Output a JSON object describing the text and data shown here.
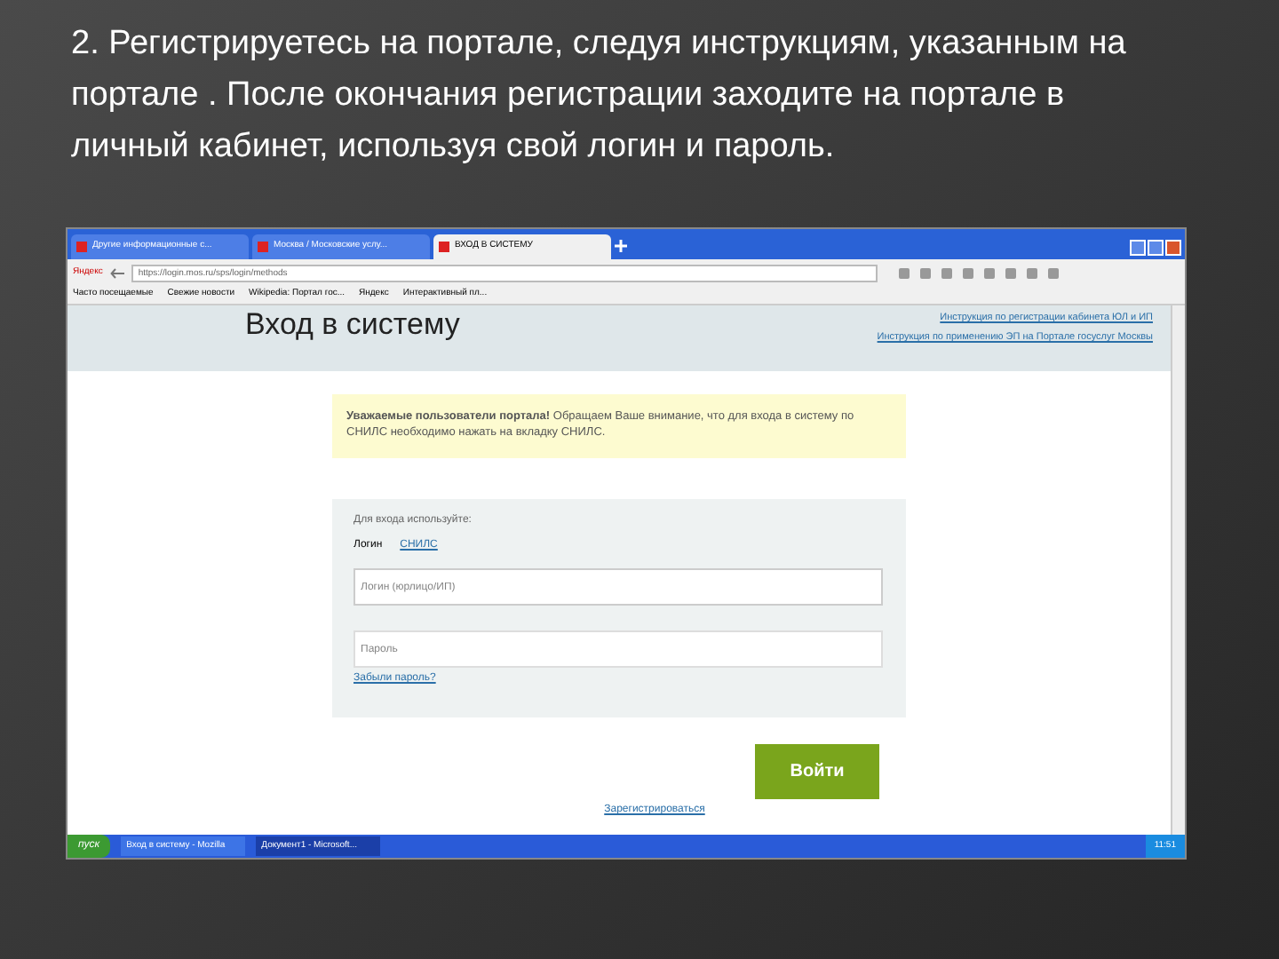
{
  "slide": {
    "heading": "2. Регистрируетесь на портале, следуя инструкциям, указанным на портале . После окончания регистрации заходите на портале в личный кабинет, используя свой логин и пароль."
  },
  "browser": {
    "tabs": [
      {
        "label": "Другие информационные с...",
        "selected": false
      },
      {
        "label": "Москва / Московские услу...",
        "selected": false
      },
      {
        "label": "ВХОД В СИСТЕМУ",
        "selected": true
      }
    ],
    "brand": "Яндекс",
    "address": "https://login.mos.ru/sps/login/methods",
    "bookmarks": [
      "Часто посещаемые",
      "Свежие новости",
      "Wikipedia: Портал гос...",
      "Яндекс",
      "Интерактивный пл..."
    ]
  },
  "page": {
    "title": "Вход в систему",
    "links": [
      "Инструкция по регистрации кабинета ЮЛ и ИП",
      "Инструкция по применению ЭП на Портале госуслуг Москвы"
    ],
    "notice_bold": "Уважаемые пользователи портала!",
    "notice": "Обращаем Ваше внимание, что для входа в систему по СНИЛС необходимо нажать на вкладку СНИЛС.",
    "form_heading": "Для входа используйте:",
    "login_tabs": [
      {
        "label": "Логин",
        "selected": true
      },
      {
        "label": "СНИЛС",
        "selected": false
      }
    ],
    "login_placeholder": "Логин (юрлицо/ИП)",
    "password_placeholder": "Пароль",
    "forgot": "Забыли пароль?",
    "submit": "Войти",
    "register": "Зарегистрироваться"
  },
  "taskbar": {
    "start": "пуск",
    "windows": [
      {
        "label": "Вход в систему - Mozilla",
        "selected": false
      },
      {
        "label": "Документ1 - Microsoft...",
        "selected": true
      }
    ],
    "clock": "11:51"
  }
}
